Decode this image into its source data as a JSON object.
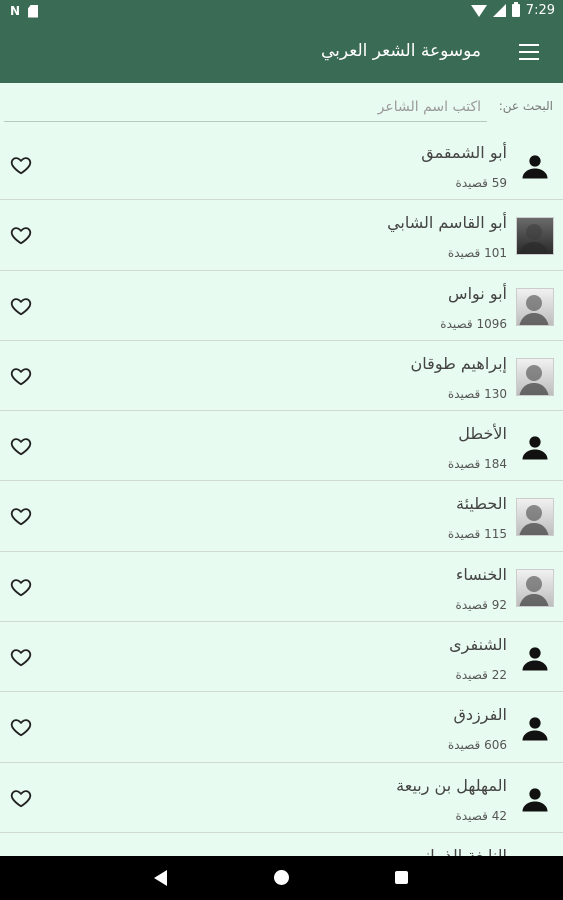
{
  "status_bar": {
    "time": "7:29",
    "icons": [
      "n-icon",
      "sd-card-icon",
      "wifi-icon",
      "signal-icon",
      "battery-icon"
    ]
  },
  "app_bar": {
    "title": "موسوعة الشعر العربي",
    "menu_icon": "menu-icon"
  },
  "search": {
    "label": "البحث عن:",
    "placeholder": "اكتب اسم الشاعر",
    "value": ""
  },
  "poets": [
    {
      "name": "أبو الشمقمق",
      "count": "59 قصيدة",
      "avatar": "person-icon"
    },
    {
      "name": "أبو القاسم الشابي",
      "count": "101 قصيدة",
      "avatar": "photo"
    },
    {
      "name": "أبو نواس",
      "count": "1096 قصيدة",
      "avatar": "photo"
    },
    {
      "name": "إبراهيم طوقان",
      "count": "130 قصيدة",
      "avatar": "photo"
    },
    {
      "name": "الأخطل",
      "count": "184 قصيدة",
      "avatar": "person-icon"
    },
    {
      "name": "الحطيئة",
      "count": "115 قصيدة",
      "avatar": "photo"
    },
    {
      "name": "الخنساء",
      "count": "92 قصيدة",
      "avatar": "photo"
    },
    {
      "name": "الشنفرى",
      "count": "22 قصيدة",
      "avatar": "person-icon"
    },
    {
      "name": "الفرزدق",
      "count": "606 قصيدة",
      "avatar": "person-icon"
    },
    {
      "name": "المهلهل بن ربيعة",
      "count": "42 قصيدة",
      "avatar": "person-icon"
    },
    {
      "name": "النابغة الذبياني",
      "count": "",
      "avatar": "person-icon"
    }
  ],
  "favorite_icon": "heart-outline-icon",
  "nav_bar": {
    "icons": [
      "back-icon",
      "home-icon",
      "recents-icon"
    ]
  },
  "colors": {
    "primary": "#3a6b54",
    "background": "#e8fbf0",
    "divider": "#cfd9d3"
  }
}
